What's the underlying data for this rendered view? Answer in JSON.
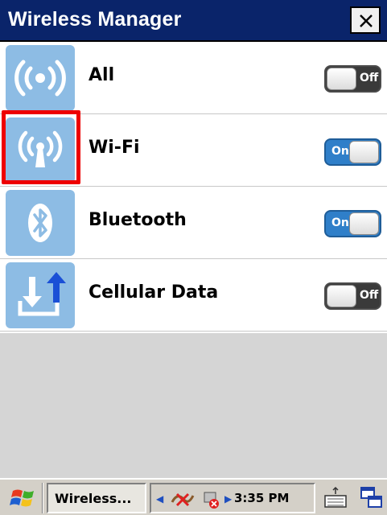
{
  "window": {
    "title": "Wireless Manager",
    "close_label": "close"
  },
  "rows": [
    {
      "label": "All",
      "icon": "broadcast-icon",
      "state": "Off"
    },
    {
      "label": "Wi-Fi",
      "icon": "wifi-antenna-icon",
      "state": "On"
    },
    {
      "label": "Bluetooth",
      "icon": "bluetooth-icon",
      "state": "On"
    },
    {
      "label": "Cellular Data",
      "icon": "cellular-data-icon",
      "state": "Off"
    }
  ],
  "taskbar": {
    "start_icon": "windows-flag-icon",
    "active_task": "Wireless...",
    "clock": "3:35 PM",
    "tray_icons": [
      "network-disconnected-icon",
      "volume-muted-icon"
    ],
    "keyboard_icon": "keyboard-icon",
    "windows_icon": "switch-windows-icon"
  },
  "colors": {
    "titlebar": "#0a246a",
    "icon_tile": "#8dbce4",
    "toggle_on": "#2f7fc9",
    "toggle_off": "#3a3a3a",
    "highlight": "#ee0000"
  }
}
